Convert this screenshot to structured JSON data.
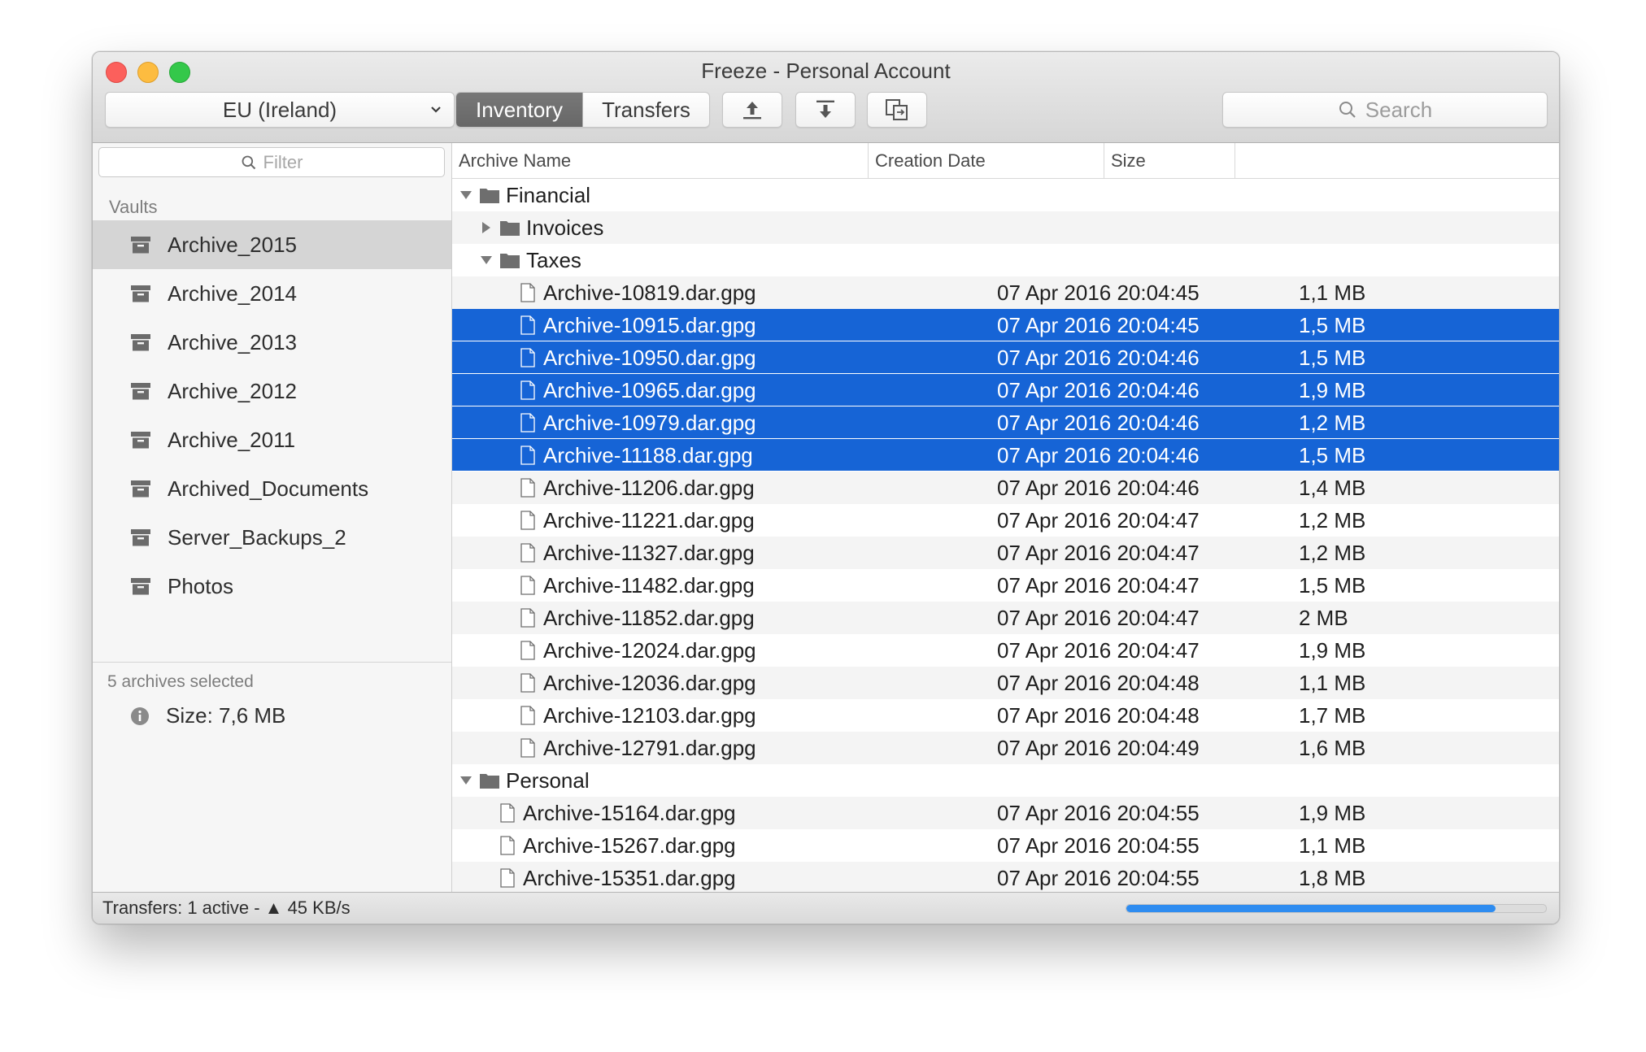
{
  "window": {
    "title": "Freeze - Personal Account"
  },
  "toolbar": {
    "region": "EU (Ireland)",
    "tabs": [
      {
        "label": "Inventory",
        "active": true
      },
      {
        "label": "Transfers",
        "active": false
      }
    ],
    "upload_icon": "upload-icon",
    "download_icon": "download-icon",
    "copy_icon": "copy-icon",
    "search_placeholder": "Search"
  },
  "sidebar": {
    "filter_placeholder": "Filter",
    "section_label": "Vaults",
    "vaults": [
      {
        "label": "Archive_2015",
        "selected": true
      },
      {
        "label": "Archive_2014"
      },
      {
        "label": "Archive_2013"
      },
      {
        "label": "Archive_2012"
      },
      {
        "label": "Archive_2011"
      },
      {
        "label": "Archived_Documents"
      },
      {
        "label": "Server_Backups_2"
      },
      {
        "label": "Photos"
      }
    ],
    "selection": {
      "count": "5 archives selected",
      "size": "Size: 7,6 MB"
    }
  },
  "table": {
    "columns": [
      "Archive Name",
      "Creation Date",
      "Size"
    ],
    "rows": [
      {
        "type": "folder",
        "level": 0,
        "expanded": true,
        "name": "Financial"
      },
      {
        "type": "folder",
        "level": 1,
        "expanded": false,
        "name": "Invoices"
      },
      {
        "type": "folder",
        "level": 1,
        "expanded": true,
        "name": "Taxes"
      },
      {
        "type": "file",
        "level": 2,
        "name": "Archive-10819.dar.gpg",
        "date": "07 Apr 2016 20:04:45",
        "size": "1,1 MB"
      },
      {
        "type": "file",
        "level": 2,
        "name": "Archive-10915.dar.gpg",
        "date": "07 Apr 2016 20:04:45",
        "size": "1,5 MB",
        "selected": true
      },
      {
        "type": "file",
        "level": 2,
        "name": "Archive-10950.dar.gpg",
        "date": "07 Apr 2016 20:04:46",
        "size": "1,5 MB",
        "selected": true
      },
      {
        "type": "file",
        "level": 2,
        "name": "Archive-10965.dar.gpg",
        "date": "07 Apr 2016 20:04:46",
        "size": "1,9 MB",
        "selected": true
      },
      {
        "type": "file",
        "level": 2,
        "name": "Archive-10979.dar.gpg",
        "date": "07 Apr 2016 20:04:46",
        "size": "1,2 MB",
        "selected": true
      },
      {
        "type": "file",
        "level": 2,
        "name": "Archive-11188.dar.gpg",
        "date": "07 Apr 2016 20:04:46",
        "size": "1,5 MB",
        "selected": true
      },
      {
        "type": "file",
        "level": 2,
        "name": "Archive-11206.dar.gpg",
        "date": "07 Apr 2016 20:04:46",
        "size": "1,4 MB"
      },
      {
        "type": "file",
        "level": 2,
        "name": "Archive-11221.dar.gpg",
        "date": "07 Apr 2016 20:04:47",
        "size": "1,2 MB"
      },
      {
        "type": "file",
        "level": 2,
        "name": "Archive-11327.dar.gpg",
        "date": "07 Apr 2016 20:04:47",
        "size": "1,2 MB"
      },
      {
        "type": "file",
        "level": 2,
        "name": "Archive-11482.dar.gpg",
        "date": "07 Apr 2016 20:04:47",
        "size": "1,5 MB"
      },
      {
        "type": "file",
        "level": 2,
        "name": "Archive-11852.dar.gpg",
        "date": "07 Apr 2016 20:04:47",
        "size": "2 MB"
      },
      {
        "type": "file",
        "level": 2,
        "name": "Archive-12024.dar.gpg",
        "date": "07 Apr 2016 20:04:47",
        "size": "1,9 MB"
      },
      {
        "type": "file",
        "level": 2,
        "name": "Archive-12036.dar.gpg",
        "date": "07 Apr 2016 20:04:48",
        "size": "1,1 MB"
      },
      {
        "type": "file",
        "level": 2,
        "name": "Archive-12103.dar.gpg",
        "date": "07 Apr 2016 20:04:48",
        "size": "1,7 MB"
      },
      {
        "type": "file",
        "level": 2,
        "name": "Archive-12791.dar.gpg",
        "date": "07 Apr 2016 20:04:49",
        "size": "1,6 MB"
      },
      {
        "type": "folder",
        "level": 0,
        "expanded": true,
        "name": "Personal"
      },
      {
        "type": "file",
        "level": 1,
        "name": "Archive-15164.dar.gpg",
        "date": "07 Apr 2016 20:04:55",
        "size": "1,9 MB"
      },
      {
        "type": "file",
        "level": 1,
        "name": "Archive-15267.dar.gpg",
        "date": "07 Apr 2016 20:04:55",
        "size": "1,1 MB"
      },
      {
        "type": "file",
        "level": 1,
        "name": "Archive-15351.dar.gpg",
        "date": "07 Apr 2016 20:04:55",
        "size": "1,8 MB"
      }
    ]
  },
  "statusbar": {
    "text": "Transfers: 1 active - ▲ 45 KB/s",
    "progress": 0.88
  },
  "colors": {
    "selection": "#1664d6",
    "progress": "#2e8cf0"
  }
}
